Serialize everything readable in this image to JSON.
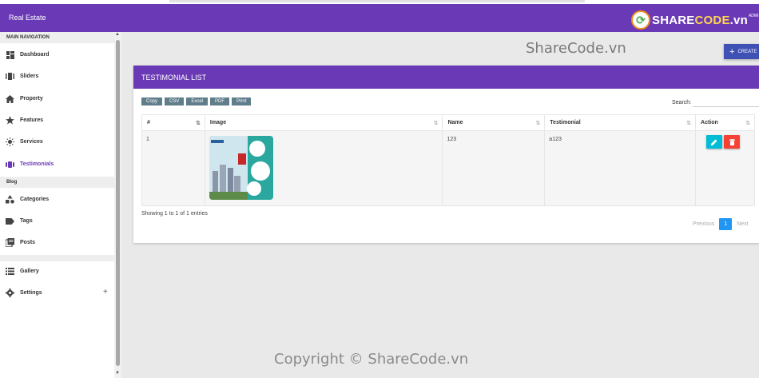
{
  "app": {
    "title": "Real Estate"
  },
  "logo": {
    "word_a": "SHARE",
    "word_b": "CODE",
    "word_c": ".vn",
    "tail": "ADMI"
  },
  "sidebar": {
    "section_main": "MAIN NAVIGATION",
    "section_blog": "Blog",
    "items": [
      {
        "label": "Dashboard",
        "icon": "dashboard-icon"
      },
      {
        "label": "Sliders",
        "icon": "slider-icon"
      },
      {
        "label": "Property",
        "icon": "home-icon"
      },
      {
        "label": "Features",
        "icon": "star-icon"
      },
      {
        "label": "Services",
        "icon": "sun-icon"
      },
      {
        "label": "Testimonials",
        "icon": "testimonial-icon"
      },
      {
        "label": "Categories",
        "icon": "shapes-icon"
      },
      {
        "label": "Tags",
        "icon": "tag-icon"
      },
      {
        "label": "Posts",
        "icon": "posts-icon"
      },
      {
        "label": "Gallery",
        "icon": "list-icon"
      },
      {
        "label": "Settings",
        "icon": "gear-icon"
      }
    ],
    "expand_symbol": "+",
    "accent": "#6a3ab6"
  },
  "watermarks": {
    "top": "ShareCode.vn",
    "bottom": "Copyright © ShareCode.vn"
  },
  "create_button": {
    "label": "CREATE"
  },
  "card": {
    "title": "TESTIMONIAL LIST",
    "export_buttons": [
      "Copy",
      "CSV",
      "Excel",
      "PDF",
      "Print"
    ],
    "search_label": "Search:",
    "columns": [
      "#",
      "Image",
      "Name",
      "Testimonial",
      "Action"
    ],
    "rows": [
      {
        "index": "1",
        "name": "123",
        "testimonial": "a123"
      }
    ],
    "info": "Showing 1 to 1 of 1 entries",
    "pager": {
      "previous": "Previous",
      "current": "1",
      "next": "Next"
    }
  },
  "colors": {
    "primary": "#6a3ab6",
    "create": "#3f51b5",
    "edit": "#00bcd4",
    "delete": "#f44336",
    "page_active": "#2196f3",
    "tool": "#607d8b"
  }
}
